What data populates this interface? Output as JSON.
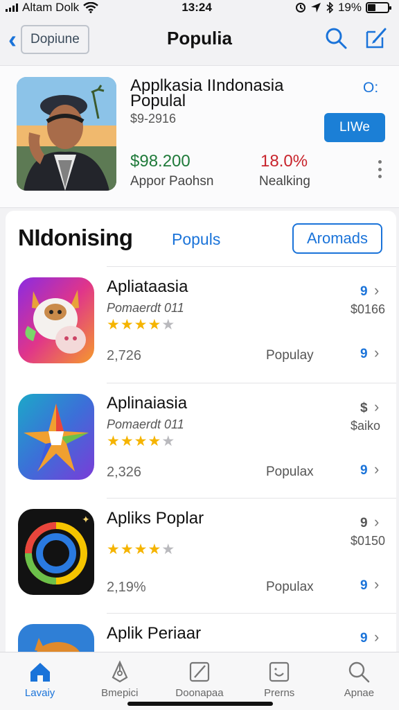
{
  "status": {
    "carrier": "Altam Dolk",
    "time": "13:24",
    "battery": "19%"
  },
  "nav": {
    "back_label": "Dopiune",
    "title": "Populia"
  },
  "featured": {
    "title": "Applkasia IIndonasia Populal",
    "subtitle": "$9-2916",
    "corner": "O:",
    "button": "LIWe",
    "price": "$98.200",
    "price_label": "Appor Paohsn",
    "percent": "18.0%",
    "percent_label": "Nealking"
  },
  "list": {
    "title": "NIdonising",
    "link": "Populs",
    "button": "Aromads",
    "apps": [
      {
        "name": "Apliataasia",
        "developer": "Pomaerdt 011",
        "rating": 4,
        "downloads": "2,726",
        "tag": "Populay",
        "rank_top": "9",
        "price": "$0166",
        "rank_bottom": "9"
      },
      {
        "name": "Aplinaiasia",
        "developer": "Pomaerdt 011",
        "rating": 4,
        "downloads": "2,326",
        "tag": "Populax",
        "rank_top": "$",
        "price": "$aiko",
        "rank_bottom": "9"
      },
      {
        "name": "Apliks Poplar",
        "developer": "",
        "rating": 4,
        "downloads": "2,19%",
        "tag": "Populax",
        "rank_top": "9",
        "price": "$0150",
        "rank_bottom": "9"
      },
      {
        "name": "Aplik Periaar",
        "developer": "",
        "rating": 0,
        "downloads": "",
        "tag": "",
        "rank_top": "9",
        "price": "",
        "rank_bottom": ""
      }
    ]
  },
  "tabs": [
    {
      "label": "Lavaiy",
      "icon": "home-icon",
      "active": true
    },
    {
      "label": "Bmepici",
      "icon": "pen-tool-icon",
      "active": false
    },
    {
      "label": "Doonapaa",
      "icon": "edit-icon",
      "active": false
    },
    {
      "label": "Prerns",
      "icon": "smiley-box-icon",
      "active": false
    },
    {
      "label": "Apnae",
      "icon": "search-icon",
      "active": false
    }
  ],
  "colors": {
    "accent": "#1a73d9",
    "price_green": "#1f7a3a",
    "percent_red": "#c8242c",
    "star": "#f5b400"
  }
}
